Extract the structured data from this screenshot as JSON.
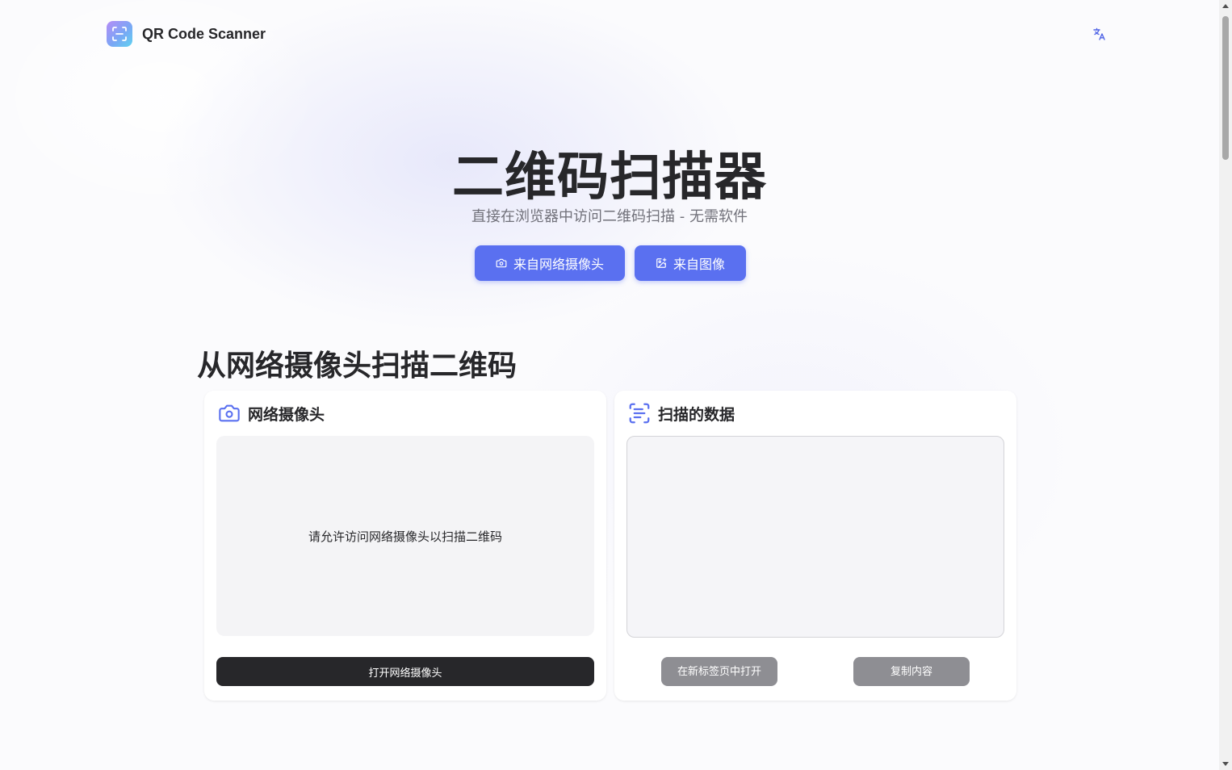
{
  "header": {
    "brand": "QR Code Scanner",
    "logo_icon": "scan-icon",
    "language_icon": "translate-icon"
  },
  "hero": {
    "title": "二维码扫描器",
    "subtitle": "直接在浏览器中访问二维码扫描 - 无需软件",
    "from_webcam_label": "来自网络摄像头",
    "from_image_label": "来自图像"
  },
  "section": {
    "title": "从网络摄像头扫描二维码"
  },
  "webcam_card": {
    "title": "网络摄像头",
    "icon": "camera-icon",
    "message": "请允许访问网络摄像头以扫描二维码",
    "open_button": "打开网络摄像头"
  },
  "data_card": {
    "title": "扫描的数据",
    "icon": "scan-text-icon",
    "textarea_value": "",
    "open_new_tab_button": "在新标签页中打开",
    "copy_button": "复制内容"
  },
  "colors": {
    "primary": "#5a70f0",
    "dark": "#27272a",
    "disabled": "#8e8e93"
  }
}
